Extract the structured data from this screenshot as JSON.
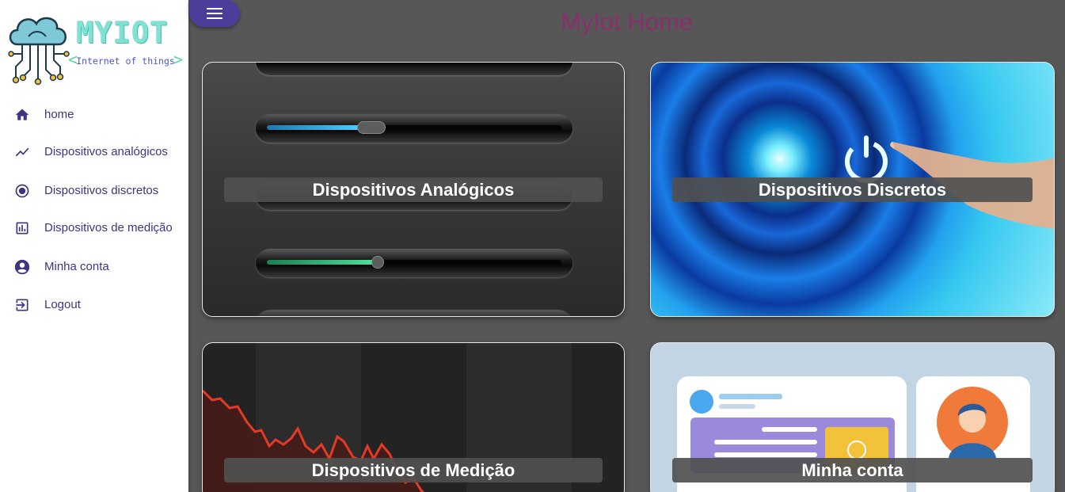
{
  "app": {
    "logo_title": "MYIOT",
    "logo_subtitle": "Internet of things"
  },
  "sidebar": {
    "items": [
      {
        "label": "home",
        "icon": "home-icon"
      },
      {
        "label": "Dispositivos analógicos",
        "icon": "trending-icon"
      },
      {
        "label": "Dispositivos discretos",
        "icon": "radio-button-icon"
      },
      {
        "label": "Dispositivos de medição",
        "icon": "bar-chart-icon"
      },
      {
        "label": "Minha conta",
        "icon": "account-circle-icon"
      },
      {
        "label": "Logout",
        "icon": "logout-icon"
      }
    ]
  },
  "header": {
    "menu_icon": "hamburger-icon",
    "title": "MyIot Home"
  },
  "cards": [
    {
      "label": "Dispositivos Analógicos"
    },
    {
      "label": "Dispositivos Discretos"
    },
    {
      "label": "Dispositivos de Medição"
    },
    {
      "label": "Minha conta"
    }
  ],
  "colors": {
    "accent": "#4a3e9a",
    "title": "#8a2f6e",
    "background": "#575757",
    "nav_text": "#3d3580"
  }
}
